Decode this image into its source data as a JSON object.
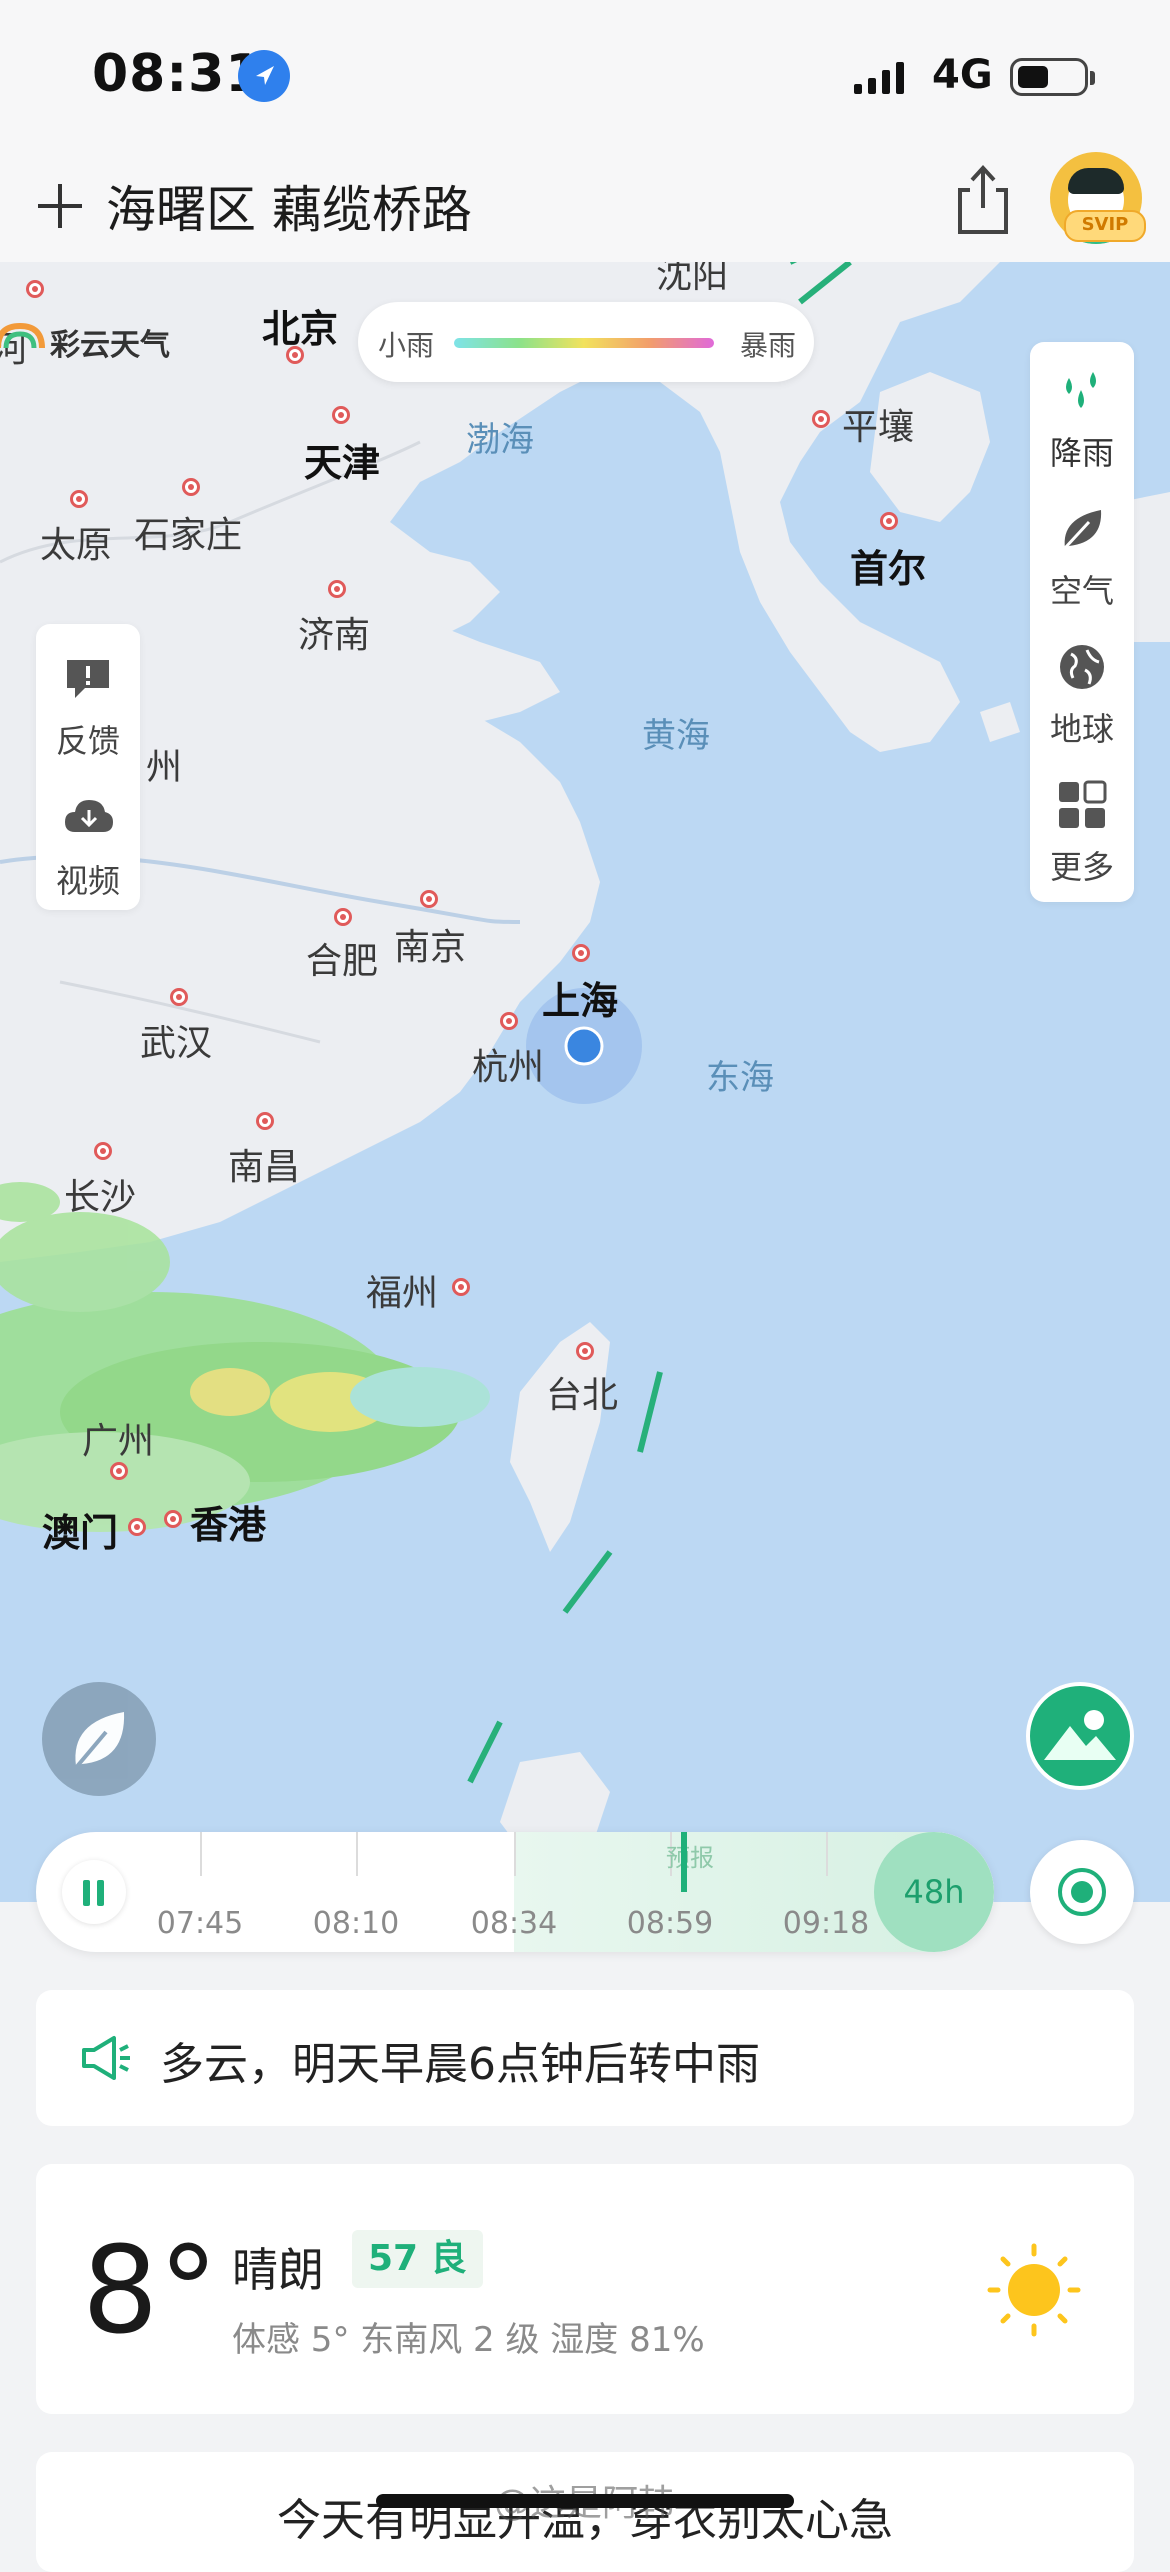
{
  "status_bar": {
    "time": "08:31",
    "network": "4G",
    "battery_percent": 40
  },
  "header": {
    "location": "海曙区 藕缆桥路",
    "badge": "SVIP"
  },
  "map": {
    "legend": {
      "min_label": "小雨",
      "max_label": "暴雨"
    },
    "brand": "彩云天气",
    "cities": [
      {
        "name": "北京",
        "big": true
      },
      {
        "name": "天津",
        "big": true
      },
      {
        "name": "太原"
      },
      {
        "name": "石家庄"
      },
      {
        "name": "济南"
      },
      {
        "name": "平壤"
      },
      {
        "name": "首尔",
        "big": true
      },
      {
        "name": "合肥"
      },
      {
        "name": "南京"
      },
      {
        "name": "上海",
        "big": true
      },
      {
        "name": "杭州"
      },
      {
        "name": "武汉"
      },
      {
        "name": "南昌"
      },
      {
        "name": "长沙"
      },
      {
        "name": "福州"
      },
      {
        "name": "台北"
      },
      {
        "name": "广州"
      },
      {
        "name": "澳门",
        "big": true
      },
      {
        "name": "香港",
        "big": true
      },
      {
        "name": "沈阳"
      },
      {
        "name": "州"
      },
      {
        "name": "河"
      }
    ],
    "seas": [
      "渤海",
      "黄海",
      "东海"
    ],
    "left_panel": [
      {
        "icon": "feedback-icon",
        "label": "反馈"
      },
      {
        "icon": "video-icon",
        "label": "视频"
      }
    ],
    "right_panel": [
      {
        "icon": "rain-icon",
        "label": "降雨"
      },
      {
        "icon": "air-icon",
        "label": "空气"
      },
      {
        "icon": "globe-icon",
        "label": "地球"
      },
      {
        "icon": "more-icon",
        "label": "更多"
      }
    ]
  },
  "timeline": {
    "times": [
      "07:45",
      "08:10",
      "08:34",
      "08:59",
      "09:18"
    ],
    "forecast_label": "预报",
    "range": "48h"
  },
  "alert": {
    "text": "多云，明天早晨6点钟后转中雨"
  },
  "current": {
    "temperature": "8°",
    "condition": "晴朗",
    "aqi": "57 良",
    "details": "体感 5°  东南风 2 级  湿度 81%"
  },
  "tip": {
    "text": "今天有明显升温，穿衣别太心急"
  },
  "watermark": "@这是阿韩",
  "colors": {
    "accent": "#1fb07a",
    "sea": "#bcd8f3",
    "land": "#eceef2"
  }
}
